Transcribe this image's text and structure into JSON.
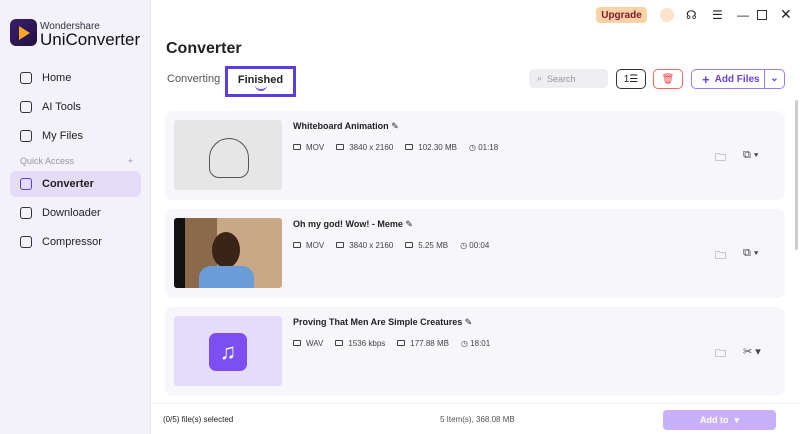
{
  "app": {
    "brand_top": "Wondershare",
    "brand_name": "UniConverter"
  },
  "sidebar": {
    "items": [
      {
        "label": "Home"
      },
      {
        "label": "AI Tools"
      },
      {
        "label": "My Files"
      }
    ],
    "quick_access": "Quick Access",
    "quick_items": [
      {
        "label": "Converter"
      },
      {
        "label": "Downloader"
      },
      {
        "label": "Compressor"
      }
    ]
  },
  "header": {
    "upgrade": "Upgrade",
    "title": "Converter",
    "tabs": [
      {
        "label": "Converting"
      },
      {
        "label": "Finished"
      }
    ],
    "search_placeholder": "Search",
    "add_files": "Add Files"
  },
  "files": [
    {
      "name": "Whiteboard Animation",
      "format": "MOV",
      "resolution": "3840 x 2160",
      "size": "102.30 MB",
      "duration": "01:18"
    },
    {
      "name": "Oh my god! Wow! - Meme",
      "format": "MOV",
      "resolution": "3840 x 2160",
      "size": "5.25 MB",
      "duration": "00:04"
    },
    {
      "name": "Proving That Men Are Simple Creatures",
      "format": "WAV",
      "resolution": "1536 kbps",
      "size": "177.88 MB",
      "duration": "18:01"
    }
  ],
  "footer": {
    "selected": "(0/5) file(s) selected",
    "summary": "5 Item(s), 368.08 MB",
    "add_to": "Add to"
  }
}
